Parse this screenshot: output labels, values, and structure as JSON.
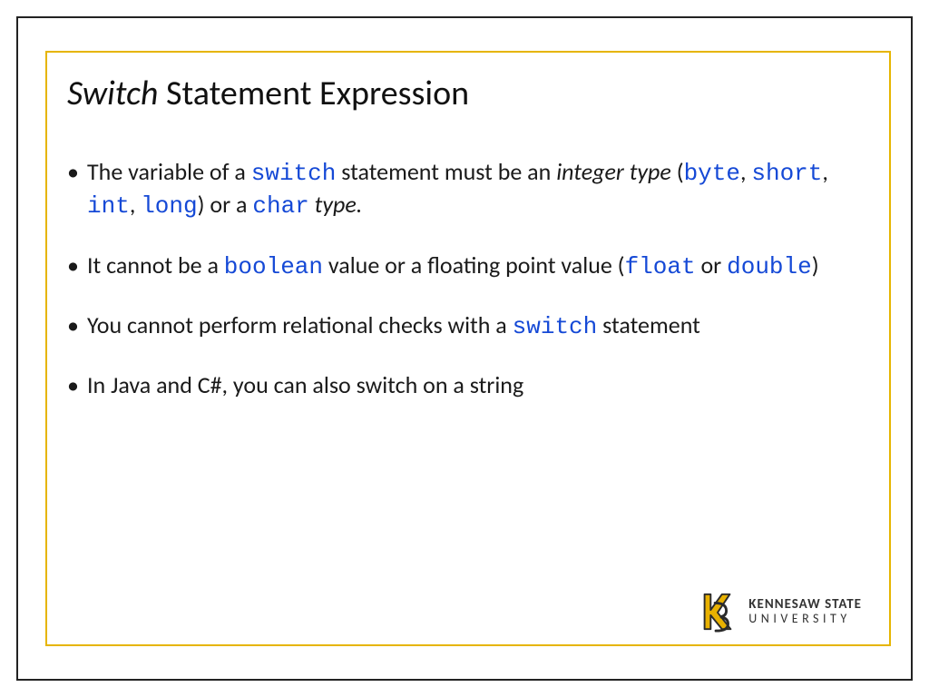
{
  "title": {
    "italic": "Switch",
    "rest": " Statement Expression"
  },
  "bullets": [
    {
      "segments": [
        {
          "t": "The variable of a ",
          "cls": ""
        },
        {
          "t": "switch",
          "cls": "kw"
        },
        {
          "t": " statement must be an ",
          "cls": ""
        },
        {
          "t": "integer type",
          "cls": "ital"
        },
        {
          "t": " (",
          "cls": ""
        },
        {
          "t": "byte",
          "cls": "kw"
        },
        {
          "t": ", ",
          "cls": ""
        },
        {
          "t": "short",
          "cls": "kw"
        },
        {
          "t": ", ",
          "cls": ""
        },
        {
          "t": "int",
          "cls": "kw"
        },
        {
          "t": ", ",
          "cls": ""
        },
        {
          "t": "long",
          "cls": "kw"
        },
        {
          "t": ") or a ",
          "cls": ""
        },
        {
          "t": "char",
          "cls": "kw"
        },
        {
          "t": " ",
          "cls": ""
        },
        {
          "t": "type.",
          "cls": "ital"
        }
      ]
    },
    {
      "segments": [
        {
          "t": "It cannot be a ",
          "cls": ""
        },
        {
          "t": "boolean",
          "cls": "kw"
        },
        {
          "t": " value or a floating point value (",
          "cls": ""
        },
        {
          "t": "float",
          "cls": "kw"
        },
        {
          "t": " or ",
          "cls": ""
        },
        {
          "t": "double",
          "cls": "kw"
        },
        {
          "t": ")",
          "cls": ""
        }
      ]
    },
    {
      "segments": [
        {
          "t": "You cannot perform relational checks with a ",
          "cls": ""
        },
        {
          "t": "switch",
          "cls": "kw"
        },
        {
          "t": " statement",
          "cls": ""
        }
      ]
    },
    {
      "segments": [
        {
          "t": "In Java and C#, you can also switch on a string",
          "cls": ""
        }
      ]
    }
  ],
  "logo": {
    "line1": "KENNESAW STATE",
    "line2": "UNIVERSITY",
    "colors": {
      "gold": "#e8b100",
      "dark": "#2b2b2b"
    }
  }
}
